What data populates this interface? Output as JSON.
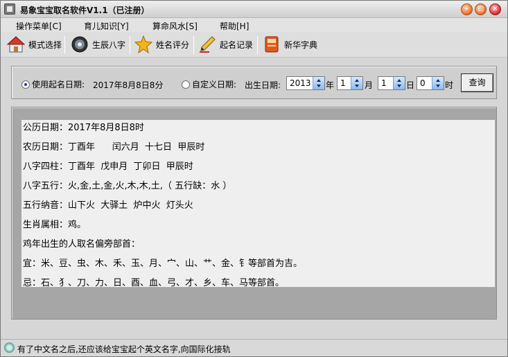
{
  "window": {
    "title": "易象宝宝取名软件V1.1（已注册）",
    "controls": [
      "minimize",
      "maximize",
      "close"
    ]
  },
  "menu": [
    {
      "label": "操作菜单[C]"
    },
    {
      "label": "育儿知识[Y]"
    },
    {
      "label": "算命风水[S]"
    },
    {
      "label": "帮助[H]"
    }
  ],
  "toolbar": [
    {
      "label": "模式选择",
      "icon": "house-icon"
    },
    {
      "label": "生辰八字",
      "icon": "camera-lens-icon"
    },
    {
      "label": "姓名评分",
      "icon": "star-icon"
    },
    {
      "label": "起名记录",
      "icon": "pen-icon"
    },
    {
      "label": "新华字典",
      "icon": "book-icon"
    }
  ],
  "query": {
    "use_date_label": "使用起名日期:",
    "use_date_value": "2017年8月8日8分",
    "custom_date_label": "自定义日期:",
    "birth_label": "出生日期:",
    "year": "2013",
    "year_unit": "年",
    "month": "1",
    "month_unit": "月",
    "day": "1",
    "day_unit": "日",
    "hour": "0",
    "hour_unit": "时",
    "query_button": "查询",
    "selected_mode": "use_date"
  },
  "result": {
    "lines": [
      "公历日期：2017年8月8日8时",
      "农历日期：丁酉年      闰六月  十七日  甲辰时",
      "八字四柱：丁酉年  戊申月  丁卯日  甲辰时",
      "八字五行：火,金,土,金,火,木,木,土,（ 五行缺：水 ）",
      "五行纳音：山下火  大驿土  炉中火  灯头火",
      "生肖属相：鸡。",
      "鸡年出生的人取名偏旁部首：",
      "宜：米、豆、虫、木、禾、玉、月、宀、山、艹、金、钅等部首为吉。",
      "忌：石、犭、刀、力、日、酉、血、弓、才、乡、车、马等部首。"
    ]
  },
  "status": {
    "text": "有了中文名之后,还应该给宝宝起个英文名字,向国际化接轨"
  },
  "colors": {
    "window_bg": "#d6d6d6",
    "result_bg": "#efefef",
    "result_frame": "#a6a6a6",
    "close_button": "#e03a3a",
    "window_button": "#f07b35"
  }
}
